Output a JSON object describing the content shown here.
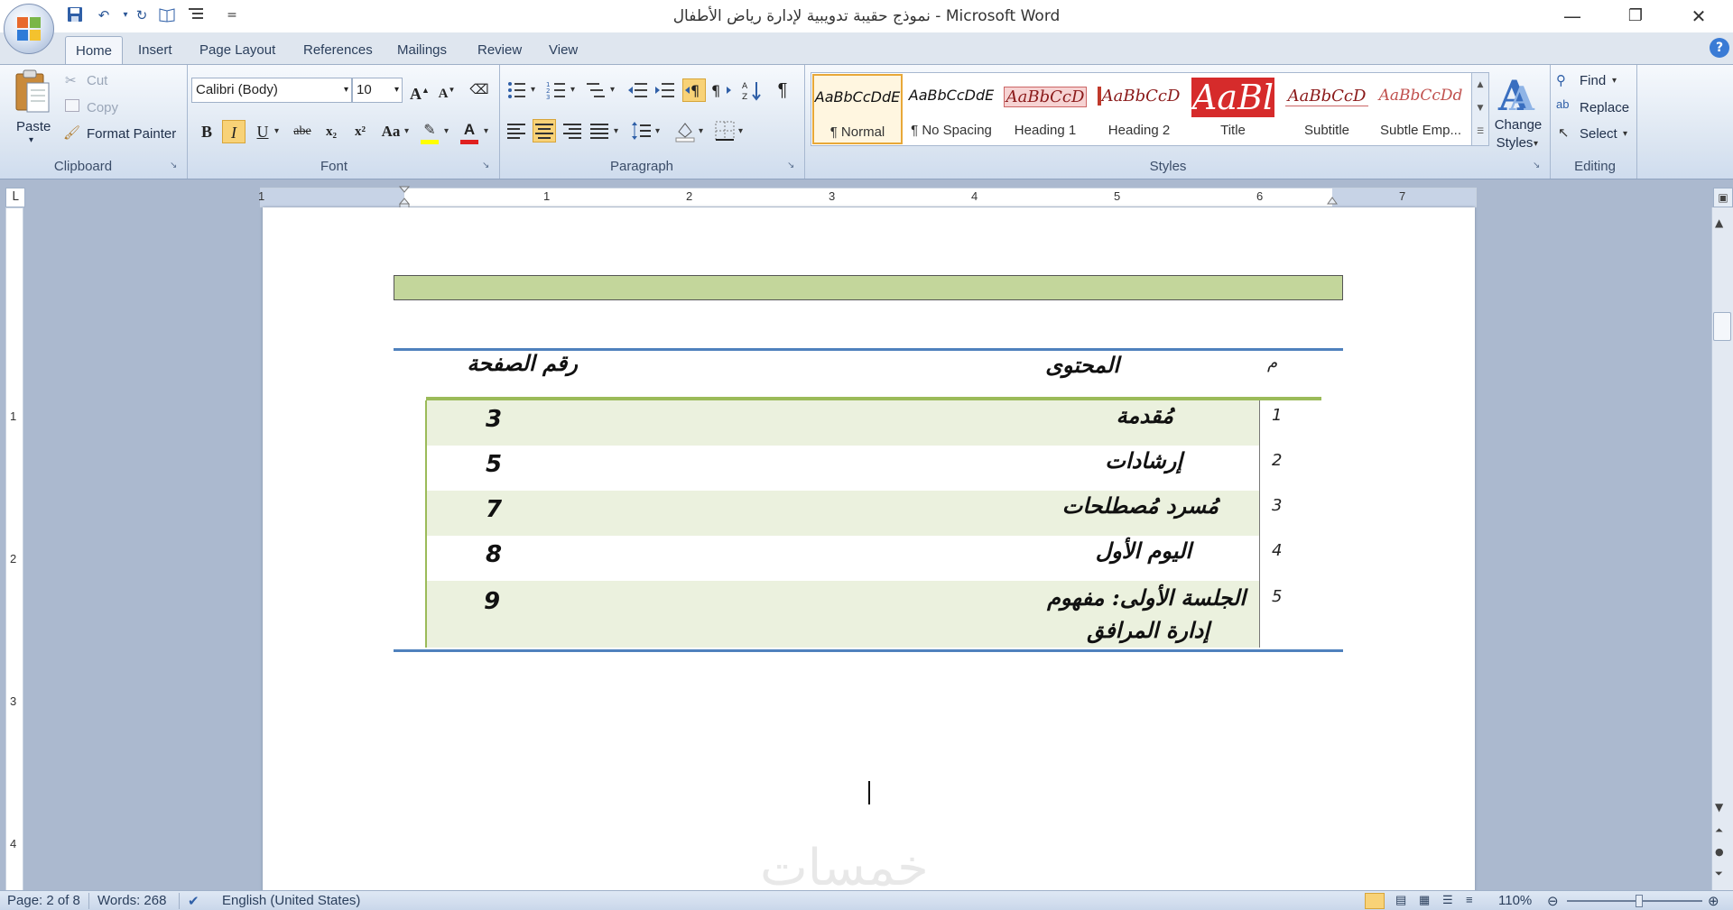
{
  "window": {
    "title": "نموذج حقيبة تدويبية لإدارة رياض الأطفال - Microsoft Word",
    "qat_customize": "="
  },
  "tabs": [
    "Home",
    "Insert",
    "Page Layout",
    "References",
    "Mailings",
    "Review",
    "View"
  ],
  "clipboard": {
    "paste": "Paste",
    "cut": "Cut",
    "copy": "Copy",
    "format_painter": "Format Painter",
    "label": "Clipboard"
  },
  "font": {
    "name": "Calibri (Body)",
    "size": "10",
    "grow": "A",
    "shrink": "A",
    "bold": "B",
    "italic": "I",
    "underline": "U",
    "strike": "abe",
    "subscript": "x₂",
    "superscript": "x²",
    "case": "Aa",
    "color_a": "A",
    "label": "Font",
    "highlight_color": "#ffff00",
    "font_color": "#e02020"
  },
  "paragraph": {
    "label": "Paragraph",
    "pilcrow": "¶"
  },
  "styles": {
    "label": "Styles",
    "items": [
      {
        "preview": "AaBbCcDdE",
        "name": "¶ Normal"
      },
      {
        "preview": "AaBbCcDdE",
        "name": "¶ No Spacing"
      },
      {
        "preview": "AaBbCcD",
        "name": "Heading 1"
      },
      {
        "preview": "AaBbCcD",
        "name": "Heading 2"
      },
      {
        "preview": "AaBl",
        "name": "Title"
      },
      {
        "preview": "AaBbCcD",
        "name": "Subtitle"
      },
      {
        "preview": "AaBbCcDd",
        "name": "Subtle Emp..."
      }
    ],
    "change_styles_line1": "Change",
    "change_styles_line2": "Styles"
  },
  "editing": {
    "label": "Editing",
    "find": "Find",
    "replace": "Replace",
    "select": "Select"
  },
  "ruler": {
    "numbers": [
      "1",
      "1",
      "2",
      "3",
      "4",
      "5",
      "6",
      "7"
    ],
    "v_numbers": [
      "1",
      "2",
      "3",
      "4"
    ],
    "tab_stop": "L"
  },
  "document": {
    "header_index": "م",
    "header_content": "المحتوى",
    "header_page": "رقم الصفحة",
    "rows": [
      {
        "index": "1",
        "content": "مُقدمة",
        "page": "3"
      },
      {
        "index": "2",
        "content": "إرشادات",
        "page": "5"
      },
      {
        "index": "3",
        "content": "مُسرد مُصطلحات",
        "page": "7"
      },
      {
        "index": "4",
        "content": "اليوم الأول",
        "page": "8"
      },
      {
        "index": "5",
        "content": "الجلسة الأولى: مفهوم",
        "content2": "إدارة  المرافق",
        "page": "9"
      }
    ],
    "watermark": "خمسات"
  },
  "status": {
    "page": "Page: 2 of 8",
    "words": "Words: 268",
    "language": "English (United States)",
    "zoom": "110%"
  }
}
